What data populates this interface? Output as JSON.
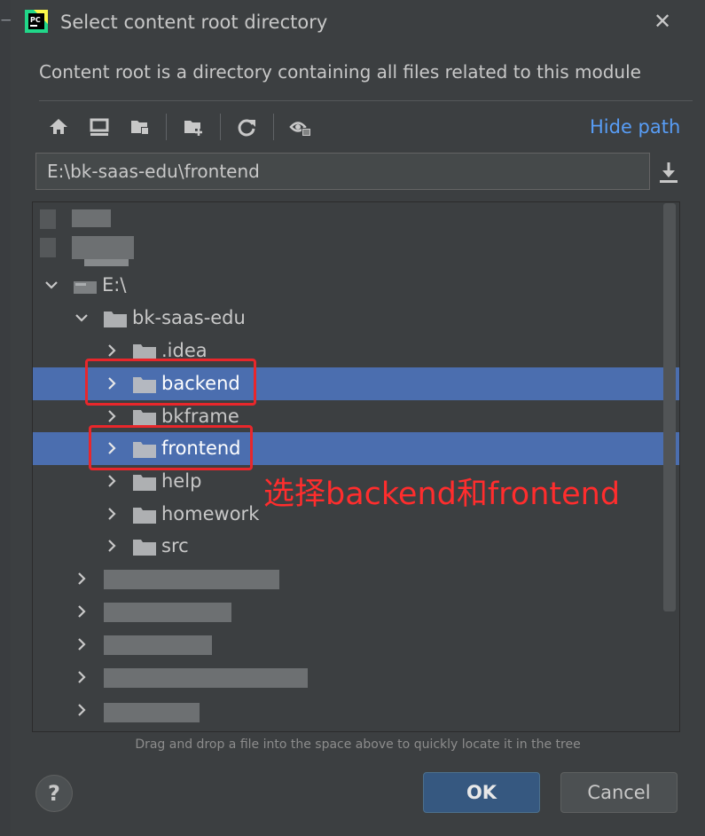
{
  "window": {
    "title": "Select content root directory",
    "close_glyph": "✕",
    "app_icon": "pycharm-icon",
    "app_icon_text": "PC"
  },
  "description": "Content root is a directory containing all files related to this module",
  "toolbar": {
    "buttons": [
      "home-icon",
      "desktop-icon",
      "project-folder-icon",
      "new-folder-icon",
      "refresh-icon",
      "show-hidden-icon"
    ],
    "hide_path_label": "Hide path",
    "accent_color": "#589df6"
  },
  "path_field": {
    "value": "E:\\bk-saas-edu\\frontend",
    "download_icon": "download-icon"
  },
  "tree": {
    "drive_label": "E:\\",
    "project_label": "bk-saas-edu",
    "children": [
      {
        "label": ".idea",
        "selected": false
      },
      {
        "label": "backend",
        "selected": true
      },
      {
        "label": "bkframe",
        "selected": false
      },
      {
        "label": "frontend",
        "selected": true
      },
      {
        "label": "help",
        "selected": false
      },
      {
        "label": "homework",
        "selected": false
      },
      {
        "label": "src",
        "selected": false
      }
    ],
    "selection_color": "#4b6eaf"
  },
  "annotation": {
    "text": "选择backend和frontend",
    "color": "#ff2d2d"
  },
  "hint": "Drag and drop a file into the space above to quickly locate it in the tree",
  "buttons": {
    "help": "?",
    "ok": "OK",
    "cancel": "Cancel"
  }
}
